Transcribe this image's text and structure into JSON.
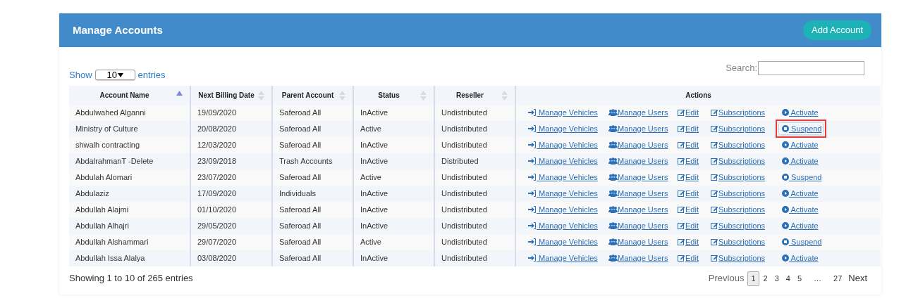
{
  "header": {
    "title": "Manage Accounts",
    "add_button": "Add Account"
  },
  "length_control": {
    "prefix": "Show",
    "value": "10",
    "suffix": "entries"
  },
  "search": {
    "label": "Search:"
  },
  "table": {
    "columns": [
      {
        "label": "Account Name",
        "sortable": true,
        "sorted": true
      },
      {
        "label": "Next Billing Date",
        "sortable": true,
        "sorted": false
      },
      {
        "label": "Parent Account",
        "sortable": true,
        "sorted": false
      },
      {
        "label": "Status",
        "sortable": true,
        "sorted": false
      },
      {
        "label": "Reseller",
        "sortable": true,
        "sorted": false
      },
      {
        "label": "Actions",
        "sortable": false,
        "sorted": false
      }
    ],
    "rows": [
      {
        "cells": [
          "Abdulwahed Alganni",
          "19/09/2020",
          "Saferoad All",
          "InActive",
          "Undistributed"
        ],
        "highlighted": false,
        "actions": [
          {
            "kind": "vehicles",
            "label": " Manage Vehicles"
          },
          {
            "kind": "users",
            "label": "Manage Users"
          },
          {
            "kind": "edit",
            "label": "Edit"
          },
          {
            "kind": "edit",
            "label": "Subscriptions"
          },
          {
            "kind": "play",
            "label": " Activate"
          }
        ]
      },
      {
        "cells": [
          "Ministry of Culture",
          "20/08/2020",
          "Saferoad All",
          "Active",
          "Undistributed"
        ],
        "highlighted": true,
        "actions": [
          {
            "kind": "vehicles",
            "label": " Manage Vehicles"
          },
          {
            "kind": "users",
            "label": "Manage Users"
          },
          {
            "kind": "edit",
            "label": "Edit"
          },
          {
            "kind": "edit",
            "label": "Subscriptions"
          },
          {
            "kind": "stop",
            "label": " Suspend"
          }
        ]
      },
      {
        "cells": [
          "shwalh contracting",
          "12/03/2020",
          "Saferoad All",
          "InActive",
          "Undistributed"
        ],
        "highlighted": false,
        "actions": [
          {
            "kind": "vehicles",
            "label": " Manage Vehicles"
          },
          {
            "kind": "users",
            "label": "Manage Users"
          },
          {
            "kind": "edit",
            "label": "Edit"
          },
          {
            "kind": "edit",
            "label": "Subscriptions"
          },
          {
            "kind": "play",
            "label": " Activate"
          }
        ]
      },
      {
        "cells": [
          "AbdalrahmanT -Delete",
          "23/09/2018",
          "Trash Accounts",
          "InActive",
          "Distributed"
        ],
        "highlighted": false,
        "actions": [
          {
            "kind": "vehicles",
            "label": " Manage Vehicles"
          },
          {
            "kind": "users",
            "label": "Manage Users"
          },
          {
            "kind": "edit",
            "label": "Edit"
          },
          {
            "kind": "edit",
            "label": "Subscriptions"
          },
          {
            "kind": "play",
            "label": " Activate"
          }
        ]
      },
      {
        "cells": [
          "Abdulah Alomari",
          "23/07/2020",
          "Saferoad All",
          "Active",
          "Undistributed"
        ],
        "highlighted": false,
        "actions": [
          {
            "kind": "vehicles",
            "label": " Manage Vehicles"
          },
          {
            "kind": "users",
            "label": "Manage Users"
          },
          {
            "kind": "edit",
            "label": "Edit"
          },
          {
            "kind": "edit",
            "label": "Subscriptions"
          },
          {
            "kind": "stop",
            "label": " Suspend"
          }
        ]
      },
      {
        "cells": [
          "Abdulaziz",
          "17/09/2020",
          "Individuals",
          "InActive",
          "Undistributed"
        ],
        "highlighted": false,
        "actions": [
          {
            "kind": "vehicles",
            "label": " Manage Vehicles"
          },
          {
            "kind": "users",
            "label": "Manage Users"
          },
          {
            "kind": "edit",
            "label": "Edit"
          },
          {
            "kind": "edit",
            "label": "Subscriptions"
          },
          {
            "kind": "play",
            "label": " Activate"
          }
        ]
      },
      {
        "cells": [
          "Abdullah Alajmi",
          "01/10/2020",
          "Saferoad All",
          "InActive",
          "Undistributed"
        ],
        "highlighted": false,
        "actions": [
          {
            "kind": "vehicles",
            "label": " Manage Vehicles"
          },
          {
            "kind": "users",
            "label": "Manage Users"
          },
          {
            "kind": "edit",
            "label": "Edit"
          },
          {
            "kind": "edit",
            "label": "Subscriptions"
          },
          {
            "kind": "play",
            "label": " Activate"
          }
        ]
      },
      {
        "cells": [
          "Abdullah Alhajri",
          "29/05/2020",
          "Saferoad All",
          "InActive",
          "Undistributed"
        ],
        "highlighted": false,
        "actions": [
          {
            "kind": "vehicles",
            "label": " Manage Vehicles"
          },
          {
            "kind": "users",
            "label": "Manage Users"
          },
          {
            "kind": "edit",
            "label": "Edit"
          },
          {
            "kind": "edit",
            "label": "Subscriptions"
          },
          {
            "kind": "play",
            "label": " Activate"
          }
        ]
      },
      {
        "cells": [
          "Abdullah Alshammari",
          "29/07/2020",
          "Saferoad All",
          "Active",
          "Undistributed"
        ],
        "highlighted": false,
        "actions": [
          {
            "kind": "vehicles",
            "label": " Manage Vehicles"
          },
          {
            "kind": "users",
            "label": "Manage Users"
          },
          {
            "kind": "edit",
            "label": "Edit"
          },
          {
            "kind": "edit",
            "label": "Subscriptions"
          },
          {
            "kind": "stop",
            "label": " Suspend"
          }
        ]
      },
      {
        "cells": [
          "Abdullah Issa Alalya",
          "03/08/2020",
          "Saferoad All",
          "InActive",
          "Undistributed"
        ],
        "highlighted": false,
        "actions": [
          {
            "kind": "vehicles",
            "label": " Manage Vehicles"
          },
          {
            "kind": "users",
            "label": "Manage Users"
          },
          {
            "kind": "edit",
            "label": "Edit"
          },
          {
            "kind": "edit",
            "label": "Subscriptions"
          },
          {
            "kind": "play",
            "label": " Activate"
          }
        ]
      }
    ]
  },
  "footer": {
    "info": "Showing 1 to 10 of 265 entries",
    "previous": "Previous",
    "next": "Next",
    "pages": [
      {
        "label": "1",
        "selected": true
      },
      {
        "label": "2",
        "selected": false
      },
      {
        "label": "3",
        "selected": false
      },
      {
        "label": "4",
        "selected": false
      },
      {
        "label": "5",
        "selected": false
      },
      {
        "label": "…",
        "selected": false
      },
      {
        "label": "27",
        "selected": false
      }
    ]
  }
}
